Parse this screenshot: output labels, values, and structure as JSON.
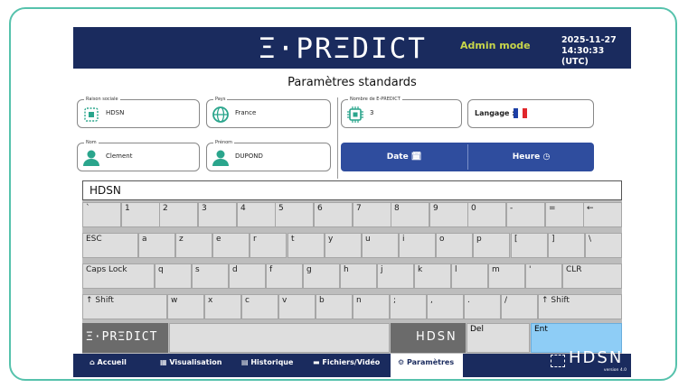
{
  "header": {
    "logo": "Ξ·PRΞDICT",
    "mode": "Admin mode",
    "date": "2025-11-27",
    "time": "14:30:33 (UTC)"
  },
  "page_title": "Paramètres standards",
  "fields": {
    "raison_sociale": {
      "legend": "Raison sociale",
      "value": "HDSN",
      "icon": "building-icon"
    },
    "pays": {
      "legend": "Pays",
      "value": "France",
      "icon": "globe-icon"
    },
    "nombre": {
      "legend": "Nombre de E-PREDICT",
      "value": "3",
      "icon": "chip-icon"
    },
    "langage": {
      "label": "Langage :",
      "icon": "french-flag-icon"
    },
    "nom": {
      "legend": "Nom",
      "value": "Clement",
      "icon": "user-icon"
    },
    "prenom": {
      "legend": "Prénom",
      "value": "DUPOND",
      "icon": "user-icon"
    }
  },
  "buttons": {
    "date": "Date",
    "heure": "Heure"
  },
  "keyboard": {
    "input_value": "HDSN",
    "row1": [
      "`",
      "1",
      "2",
      "3",
      "4",
      "5",
      "6",
      "7",
      "8",
      "9",
      "0",
      "-",
      "=",
      "←"
    ],
    "row2_first": "ESC",
    "row2": [
      "a",
      "z",
      "e",
      "r",
      "t",
      "y",
      "u",
      "i",
      "o",
      "p",
      "[",
      "]",
      "\\"
    ],
    "row3_first": "Caps Lock",
    "row3": [
      "q",
      "s",
      "d",
      "f",
      "g",
      "h",
      "j",
      "k",
      "l",
      "m",
      "'"
    ],
    "row3_last": "CLR",
    "row4_first": "↑ Shift",
    "row4": [
      "w",
      "x",
      "c",
      "v",
      "b",
      "n",
      ";",
      ",",
      ".",
      "/"
    ],
    "row4_last": "↑ Shift",
    "logo_left": "Ξ·PRΞDICT",
    "logo_right": "HDSN",
    "del": "Del",
    "ent": "Ent"
  },
  "nav": {
    "accueil": "Accueil",
    "visualisation": "Visualisation",
    "historique": "Historique",
    "fichiers": "Fichiers/Vidéo",
    "parametres": "Paramètres",
    "brand": "HDSN",
    "version": "version 4.0"
  },
  "colors": {
    "navy": "#1a2b5e",
    "accent_yellow": "#c8d64a",
    "button_blue": "#2f4d9e",
    "enter_blue": "#8ecdf6",
    "frame_teal": "#56c2ac"
  }
}
